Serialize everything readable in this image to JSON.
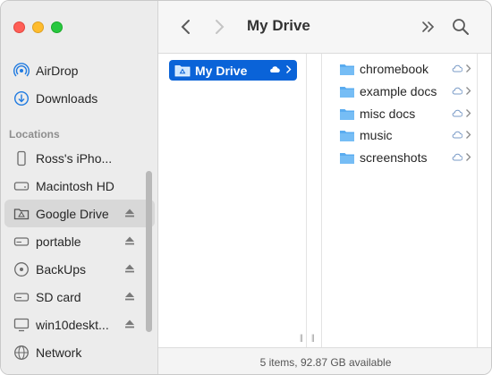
{
  "window": {
    "title": "My Drive",
    "status_text": "5 items, 92.87 GB available"
  },
  "sidebar": {
    "favorites": [
      {
        "label": "AirDrop",
        "icon": "airdrop-icon"
      },
      {
        "label": "Downloads",
        "icon": "downloads-icon"
      }
    ],
    "locations_header": "Locations",
    "locations": [
      {
        "label": "Ross's iPho...",
        "icon": "iphone-icon",
        "eject": false
      },
      {
        "label": "Macintosh HD",
        "icon": "hard-drive-icon",
        "eject": false
      },
      {
        "label": "Google Drive",
        "icon": "google-drive-icon",
        "eject": true,
        "selected": true
      },
      {
        "label": "portable",
        "icon": "external-drive-icon",
        "eject": true
      },
      {
        "label": "BackUps",
        "icon": "network-drive-icon",
        "eject": true
      },
      {
        "label": "SD card",
        "icon": "external-drive-icon",
        "eject": true
      },
      {
        "label": "win10deskt...",
        "icon": "display-icon",
        "eject": true
      },
      {
        "label": "Network",
        "icon": "network-globe-icon",
        "eject": false
      }
    ]
  },
  "column1": {
    "selected_item": {
      "label": "My Drive",
      "icon": "drive-folder-icon"
    }
  },
  "column3": {
    "items": [
      {
        "label": "chromebook"
      },
      {
        "label": "example docs"
      },
      {
        "label": "misc docs"
      },
      {
        "label": "music"
      },
      {
        "label": "screenshots"
      }
    ]
  },
  "colors": {
    "selection_blue": "#0a63d8",
    "folder_blue": "#5aacf0",
    "sidebar_bg": "#ececec"
  }
}
